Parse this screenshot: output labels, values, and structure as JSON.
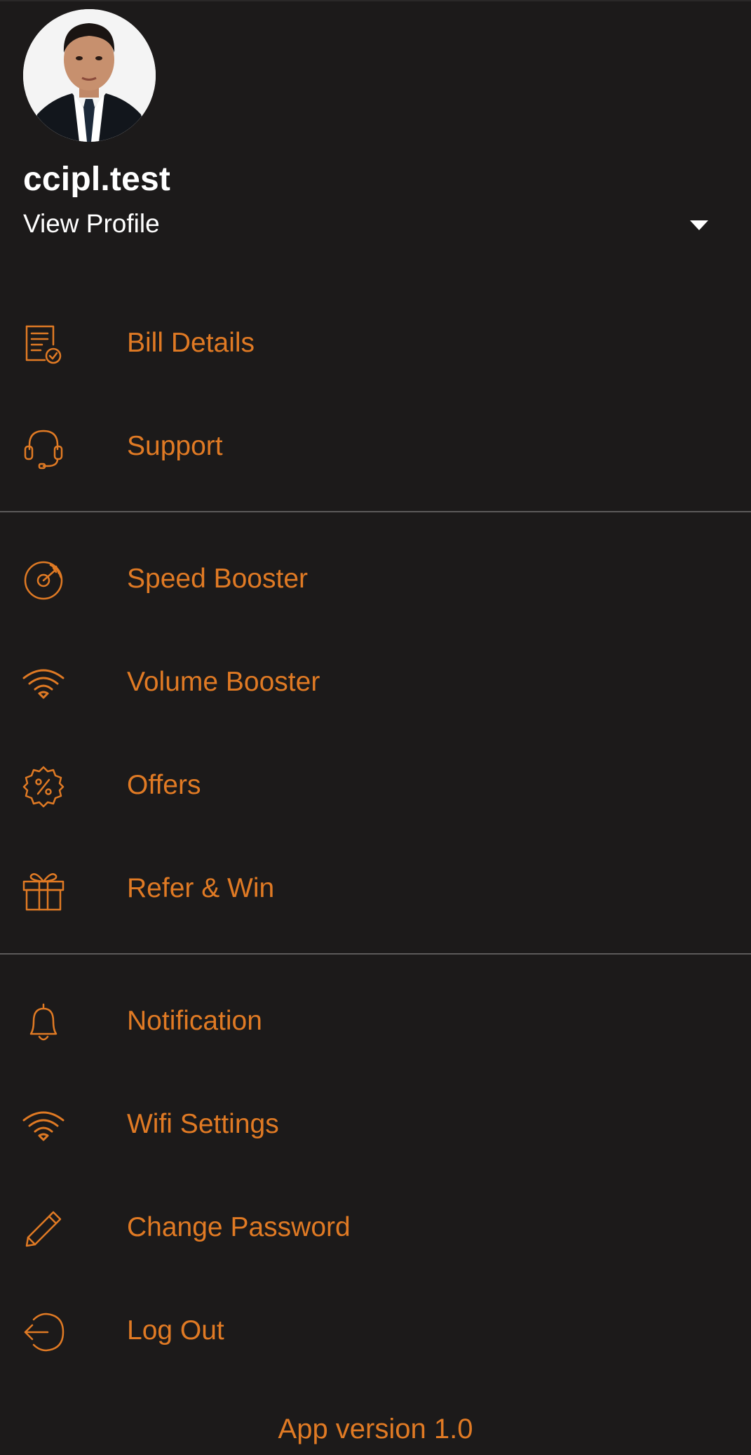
{
  "profile": {
    "username": "ccipl.test",
    "view_profile_label": "View Profile",
    "avatar_icon": "user-photo",
    "dropdown_icon": "caret-down-icon"
  },
  "colors": {
    "background": "#1c1a1a",
    "accent": "#e07a24",
    "divider": "#5c5a5a",
    "text_primary": "#ffffff"
  },
  "menu": {
    "bill_details": {
      "label": "Bill Details",
      "icon": "bill-icon"
    },
    "support": {
      "label": "Support",
      "icon": "headset-icon"
    },
    "speed_booster": {
      "label": "Speed Booster",
      "icon": "speedometer-icon"
    },
    "volume_booster": {
      "label": "Volume Booster",
      "icon": "wifi-icon"
    },
    "offers": {
      "label": "Offers",
      "icon": "percent-badge-icon"
    },
    "refer_win": {
      "label": "Refer & Win",
      "icon": "gift-icon"
    },
    "notification": {
      "label": "Notification",
      "icon": "bell-icon"
    },
    "wifi_settings": {
      "label": "Wifi Settings",
      "icon": "wifi-icon"
    },
    "change_password": {
      "label": "Change Password",
      "icon": "pencil-icon"
    },
    "log_out": {
      "label": "Log Out",
      "icon": "logout-icon"
    }
  },
  "footer": {
    "version": "App version 1.0"
  }
}
